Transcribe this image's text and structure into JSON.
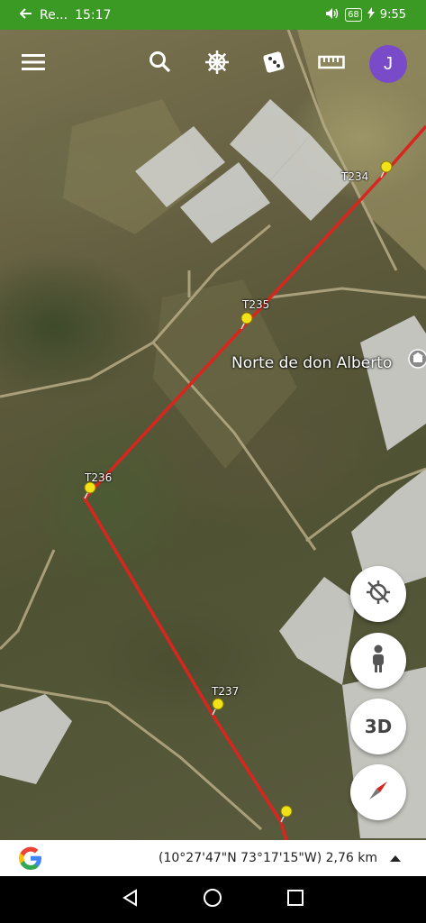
{
  "status_bar": {
    "app_label": "Re...",
    "time_left": "15:17",
    "battery": "68",
    "time_right": "9:55"
  },
  "toolbar": {
    "avatar_initial": "J"
  },
  "map": {
    "placemarks": [
      "T234",
      "T235",
      "T236",
      "T237"
    ],
    "place_name": "Norte de don Alberto"
  },
  "controls": {
    "three_d_label": "3D"
  },
  "info_bar": {
    "coordinates": "(10°27'47\"N 73°17'15\"W) 2,76 km"
  },
  "colors": {
    "status_bar": "#3b9a23",
    "route_line": "#d8261f",
    "avatar": "#7a4bc8",
    "pin": "#f2e21a"
  }
}
